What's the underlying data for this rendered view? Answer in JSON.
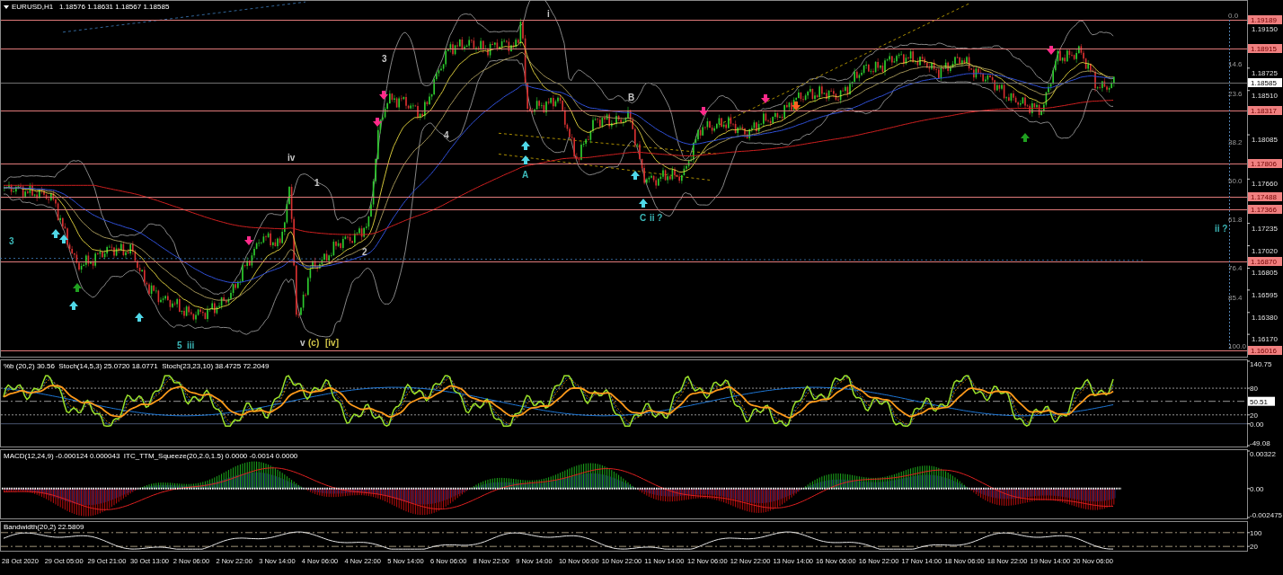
{
  "chart": {
    "symbol": "EURUSD,H1",
    "ohlc": "1.18576 1.18631 1.18567 1.18585"
  },
  "price_axis": {
    "ticks": [
      "1.19150",
      "1.18725",
      "1.18510",
      "1.18085",
      "1.17660",
      "1.17235",
      "1.17020",
      "1.16805",
      "1.16595",
      "1.16380",
      "1.16170"
    ],
    "current_price": "1.18585"
  },
  "levels": [
    "1.19189",
    "1.18915",
    "1.18317",
    "1.17806",
    "1.17488",
    "1.17366",
    "1.16870",
    "1.16016"
  ],
  "fibonacci": [
    "0.0",
    "14.6",
    "23.6",
    "38.2",
    "50.0",
    "61.8",
    "76.4",
    "85.4",
    "100.0"
  ],
  "wave_labels": [
    {
      "text": "3",
      "color": "#3cb8b8"
    },
    {
      "text": "5",
      "color": "#3cb8b8"
    },
    {
      "text": "iii",
      "color": "#3cb8b8"
    },
    {
      "text": "iv",
      "color": "#c8c8c8"
    },
    {
      "text": "v",
      "color": "#c8c8c8"
    },
    {
      "text": "(c)",
      "color": "#d4c84a"
    },
    {
      "text": "1",
      "color": "#c8c8c8"
    },
    {
      "text": "[iv]",
      "color": "#d4c84a"
    },
    {
      "text": "2",
      "color": "#c8c8c8"
    },
    {
      "text": "3",
      "color": "#c8c8c8"
    },
    {
      "text": "4",
      "color": "#c8c8c8"
    },
    {
      "text": "A",
      "color": "#3cb8b8"
    },
    {
      "text": "i",
      "color": "#c8c8c8"
    },
    {
      "text": "B",
      "color": "#c8c8c8"
    },
    {
      "text": "C",
      "color": "#3cb8b8"
    },
    {
      "text": "ii ?",
      "color": "#3cb8b8"
    },
    {
      "text": "ii ?",
      "color": "#3cb8b8"
    }
  ],
  "stochastic_pane": {
    "legend": "%b (20,2) 30.56  Stoch(14,5,3) 25.0720 18.0771  Stoch(23,23,10) 38.4725 72.2049",
    "axis": [
      {
        "text": "140.75",
        "kind": "tick"
      },
      {
        "text": "80",
        "kind": "tick"
      },
      {
        "text": "50.51",
        "kind": "current"
      },
      {
        "text": "20",
        "kind": "tick"
      },
      {
        "text": "0.00",
        "kind": "tick"
      },
      {
        "text": "-49.08",
        "kind": "tick"
      }
    ]
  },
  "macd_pane": {
    "legend": "MACD(12,24,9) -0.000124 0.000043  ITC_TTM_Squeeze(20,2.0,1.5) 0.0000 -0.0014 0.0000",
    "axis": [
      {
        "text": "0.00322",
        "kind": "tick"
      },
      {
        "text": "0.00",
        "kind": "tick"
      },
      {
        "text": "-0.002475",
        "kind": "tick"
      }
    ]
  },
  "bandwidth_pane": {
    "legend": "Bandwidth(20,2) 22.5809",
    "axis": [
      {
        "text": "100",
        "kind": "tick"
      },
      {
        "text": "20",
        "kind": "tick"
      }
    ]
  },
  "time_axis": [
    "28 Oct 2020",
    "29 Oct 05:00",
    "29 Oct 21:00",
    "30 Oct 13:00",
    "2 Nov 06:00",
    "2 Nov 22:00",
    "3 Nov 14:00",
    "4 Nov 06:00",
    "4 Nov 22:00",
    "5 Nov 14:00",
    "6 Nov 06:00",
    "8 Nov 22:00",
    "9 Nov 14:00",
    "10 Nov 06:00",
    "10 Nov 22:00",
    "11 Nov 14:00",
    "12 Nov 06:00",
    "12 Nov 22:00",
    "13 Nov 14:00",
    "16 Nov 06:00",
    "16 Nov 22:00",
    "17 Nov 14:00",
    "18 Nov 06:00",
    "18 Nov 22:00",
    "19 Nov 14:00",
    "20 Nov 06:00"
  ]
}
